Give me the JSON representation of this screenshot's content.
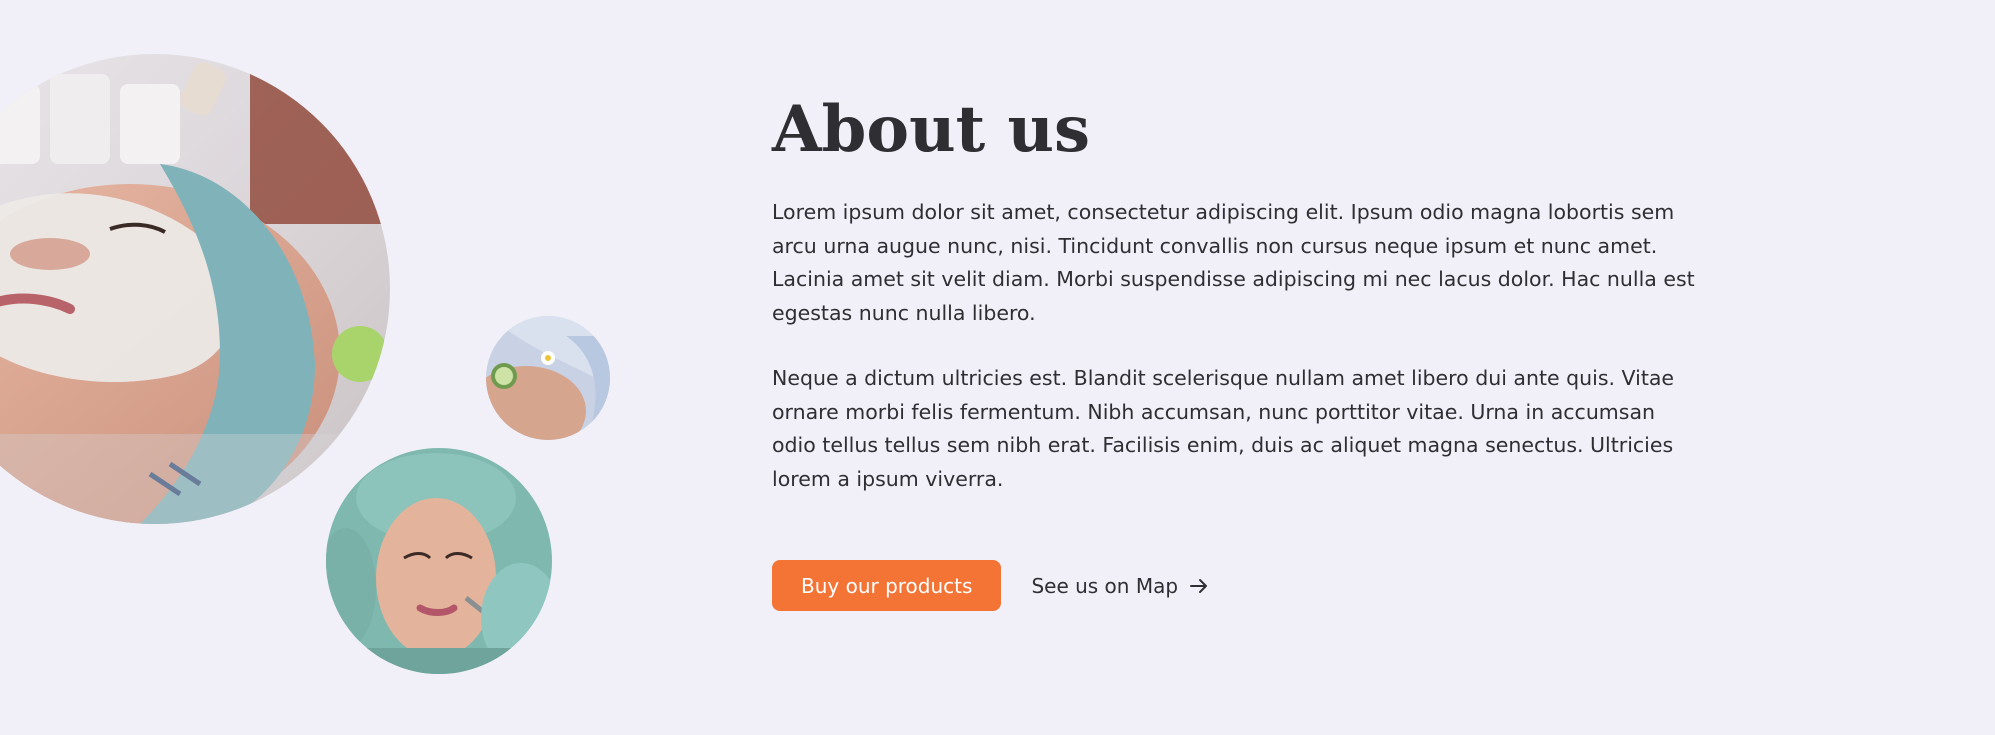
{
  "about": {
    "title": "About us",
    "paragraphs": [
      "Lorem ipsum dolor sit amet, consectetur adipiscing elit. Ipsum odio magna lobortis sem arcu urna augue nunc, nisi. Tincidunt convallis non cursus neque ipsum et nunc amet. Lacinia amet sit velit diam. Morbi suspendisse adipiscing mi nec lacus dolor. Hac nulla est egestas nunc nulla libero.",
      "Neque a dictum ultricies est. Blandit scelerisque nullam amet libero dui ante quis. Vitae ornare morbi felis fermentum. Nibh accumsan, nunc porttitor vitae. Urna in accumsan odio tellus tellus sem nibh erat. Facilisis enim, duis ac aliquet magna senectus. Ultricies lorem a ipsum viverra."
    ],
    "primary_button": "Buy our products",
    "secondary_link": "See us on Map",
    "secondary_link_icon": "arrow-right-icon"
  },
  "theme": {
    "background": "#f1f0f8",
    "accent": "#f47436",
    "text": "#2e2e33"
  },
  "images": {
    "large": "facial-mask-treatment-photo",
    "small": "cucumber-eye-treatment-photo",
    "medium": "facial-skin-care-photo"
  }
}
